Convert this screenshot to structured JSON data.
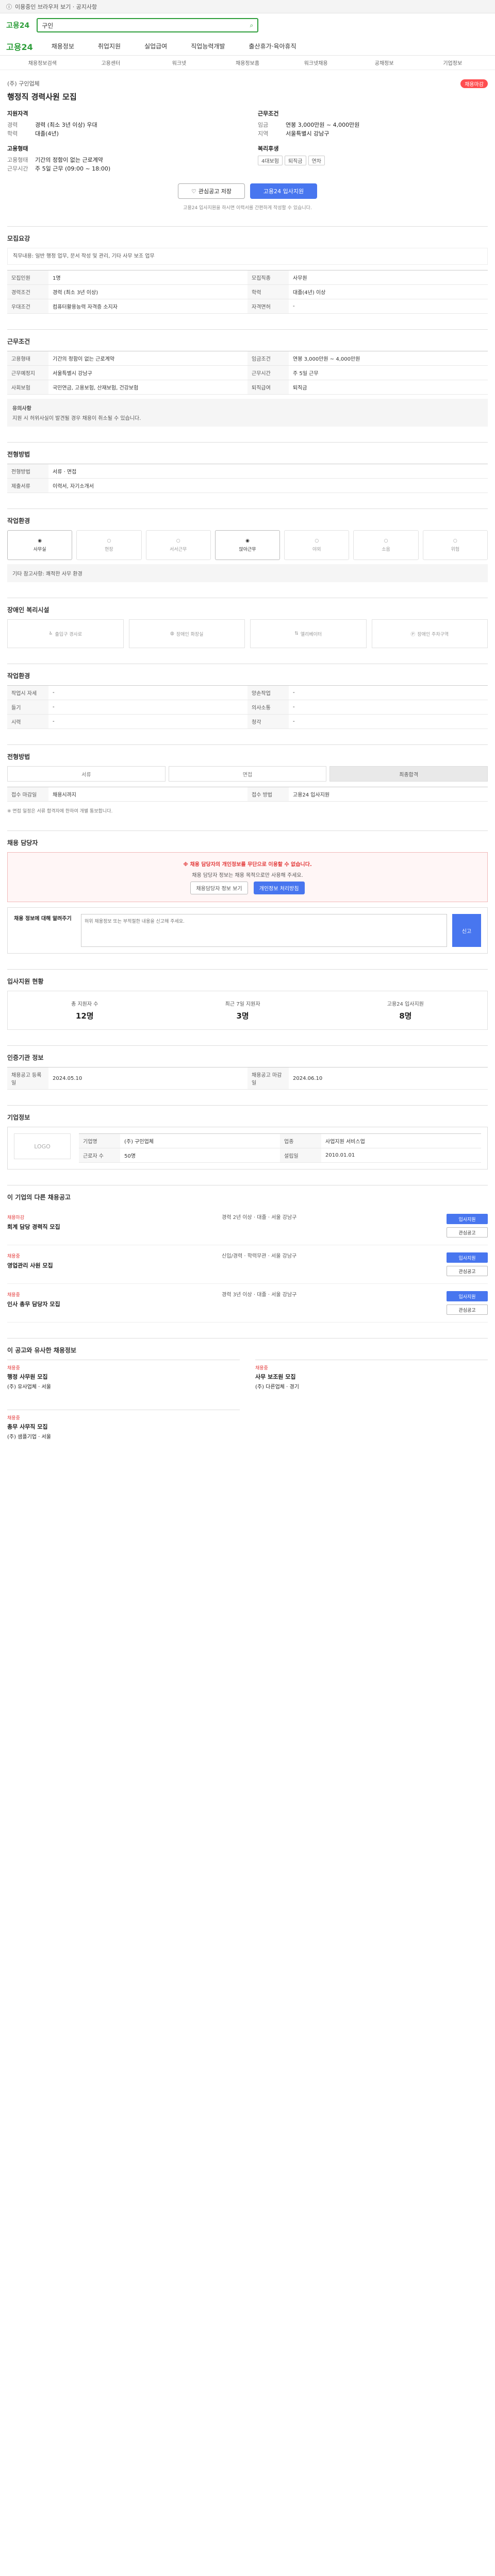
{
  "topbar": {
    "note": "이용중인 브라우저 보기 · 공지사항"
  },
  "header": {
    "logo": "고용24",
    "search_value": "구인"
  },
  "nav": {
    "brand": "고용24",
    "items": [
      "채용정보",
      "취업지원",
      "실업급여",
      "직업능력개발",
      "출산휴가·육아휴직"
    ]
  },
  "subnav": [
    "채용정보검색",
    "고용센터",
    "워크넷",
    "채용정보홈",
    "워크넷채용",
    "공채정보",
    "기업정보"
  ],
  "posting": {
    "company": "(주) 구인업체",
    "badge": "채용마감",
    "title": "행정직 경력사원 모집",
    "apply_title": "지원자격",
    "apply": [
      {
        "k": "경력",
        "v": "경력 (최소 3년 이상) 우대"
      },
      {
        "k": "학력",
        "v": "대졸(4년)"
      }
    ],
    "condition_title": "근무조건",
    "condition": [
      {
        "k": "임금",
        "v": "연봉 3,000만원 ~ 4,000만원"
      },
      {
        "k": "지역",
        "v": "서울특별시 강남구"
      }
    ],
    "extra_title": "고용형태",
    "extra": [
      {
        "k": "고용형태",
        "v": "기간의 정함이 없는 근로계약"
      },
      {
        "k": "근무시간",
        "v": "주 5일 근무 (09:00 ~ 18:00)"
      }
    ],
    "welfare_title": "복리후생",
    "welfare_chips": [
      "4대보험",
      "퇴직금",
      "연차"
    ],
    "btn_scrap": "관심공고 저장",
    "btn_apply": "고용24 입사지원",
    "tip": "고용24 입사지원을 하시면 이력서를 간편하게 작성할 수 있습니다."
  },
  "sections": {
    "recruit_title": "모집요강",
    "job_desc": "직무내용: 일반 행정 업무, 문서 작성 및 관리, 기타 사무 보조 업무",
    "recruit_table": [
      {
        "k": "모집인원",
        "v": "1명"
      },
      {
        "k": "모집직종",
        "v": "사무원"
      },
      {
        "k": "경력조건",
        "v": "경력 (최소 3년 이상)"
      },
      {
        "k": "학력",
        "v": "대졸(4년) 이상"
      },
      {
        "k": "우대조건",
        "v": "컴퓨터활용능력 자격증 소지자"
      },
      {
        "k": "자격면허",
        "v": "-"
      }
    ],
    "work_title": "근무조건",
    "work_table": [
      {
        "k": "고용형태",
        "v": "기간의 정함이 없는 근로계약"
      },
      {
        "k": "임금조건",
        "v": "연봉 3,000만원 ~ 4,000만원"
      },
      {
        "k": "근무예정지",
        "v": "서울특별시 강남구"
      },
      {
        "k": "근무시간",
        "v": "주 5일 근무"
      },
      {
        "k": "사회보험",
        "v": "국민연금, 고용보험, 산재보험, 건강보험"
      },
      {
        "k": "퇴직급여",
        "v": "퇴직금"
      }
    ],
    "notice_title": "유의사항",
    "notice_text": "지원 시 허위사실이 발견될 경우 채용이 취소될 수 있습니다.",
    "ingi_title": "전형방법",
    "ingi_table": [
      {
        "k": "전형방법",
        "v": "서류 · 면접"
      },
      {
        "k": "제출서류",
        "v": "이력서, 자기소개서"
      }
    ],
    "env_title": "작업환경",
    "env_icons": [
      {
        "label": "사무실",
        "on": true
      },
      {
        "label": "현장",
        "on": false
      },
      {
        "label": "서서근무",
        "on": false
      },
      {
        "label": "앉아근무",
        "on": true
      },
      {
        "label": "야외",
        "on": false
      },
      {
        "label": "소음",
        "on": false
      },
      {
        "label": "위험",
        "on": false
      }
    ],
    "env_note": "기타 참고사항: 쾌적한 사무 환경",
    "welfare_title": "장애인 복리시설",
    "welfare_items": [
      "출입구 경사로",
      "장애인 화장실",
      "엘리베이터",
      "장애인 주차구역"
    ],
    "workplace_title": "작업환경",
    "work_env_table": [
      {
        "k": "작업시 자세",
        "v": "-"
      },
      {
        "k": "양손작업",
        "v": "-"
      },
      {
        "k": "들기",
        "v": "-"
      },
      {
        "k": "의사소통",
        "v": "-"
      },
      {
        "k": "시력",
        "v": "-"
      },
      {
        "k": "청각",
        "v": "-"
      }
    ],
    "process_title": "전형방법",
    "process_steps": [
      "서류",
      "면접",
      "최종합격"
    ],
    "process_info": [
      {
        "k": "접수 마감일",
        "v": "채용시까지"
      },
      {
        "k": "접수 방법",
        "v": "고용24 입사지원"
      }
    ],
    "process_notice": "※ 면접 일정은 서류 합격자에 한하여 개별 통보합니다.",
    "danger_title": "채용 담당자",
    "danger_warn": "※ 채용 담당자의 개인정보를 무단으로 이용할 수 없습니다.",
    "danger_desc": "채용 담당자 정보는 채용 목적으로만 사용해 주세요.",
    "danger_btn1": "채용담당자 정보 보기",
    "danger_btn2": "개인정보 처리방침",
    "report_label": "채용 정보에 대해 알려주기",
    "report_placeholder": "허위 채용정보 또는 부적절한 내용을 신고해 주세요.",
    "report_submit": "신고",
    "stats_title": "입사지원 현황",
    "stats": [
      {
        "label": "총 지원자 수",
        "value": "12명"
      },
      {
        "label": "최근 7일 지원자",
        "value": "3명"
      },
      {
        "label": "고용24 입사지원",
        "value": "8명"
      }
    ],
    "org_title": "인증기관 정보",
    "org_table": [
      {
        "k": "채용공고 등록일",
        "v": "2024.05.10"
      },
      {
        "k": "채용공고 마감일",
        "v": "2024.06.10"
      }
    ],
    "company_title": "기업정보",
    "company_logo": "LOGO",
    "company_info": [
      {
        "k": "기업명",
        "v": "(주) 구인업체"
      },
      {
        "k": "업종",
        "v": "사업지원 서비스업"
      },
      {
        "k": "근로자 수",
        "v": "50명"
      },
      {
        "k": "설립일",
        "v": "2010.01.01"
      }
    ],
    "jobs_title": "이 기업의 다른 채용공고",
    "jobs": [
      {
        "tag": "채용마감",
        "name": "회계 담당 경력직 모집",
        "mid": "경력 2년 이상 · 대졸 · 서울 강남구",
        "btn1": "입사지원",
        "btn2": "관심공고"
      },
      {
        "tag": "채용중",
        "name": "영업관리 사원 모집",
        "mid": "신입/경력 · 학력무관 · 서울 강남구",
        "btn1": "입사지원",
        "btn2": "관심공고"
      },
      {
        "tag": "채용중",
        "name": "인사 총무 담당자 모집",
        "mid": "경력 3년 이상 · 대졸 · 서울 강남구",
        "btn1": "입사지원",
        "btn2": "관심공고"
      }
    ],
    "rec_title": "이 공고와 유사한 채용정보",
    "recs": [
      {
        "tag": "채용중",
        "name": "행정 사무원 모집",
        "info": "(주) 유사업체 · 서울"
      },
      {
        "tag": "채용중",
        "name": "사무 보조원 모집",
        "info": "(주) 다른업체 · 경기"
      },
      {
        "tag": "채용중",
        "name": "총무 사무직 모집",
        "info": "(주) 샘플기업 · 서울"
      }
    ]
  }
}
